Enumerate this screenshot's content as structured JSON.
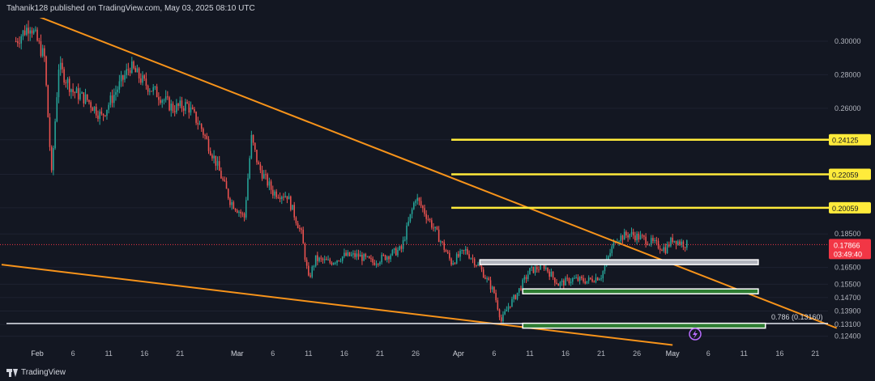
{
  "header": {
    "title": "Tahanik128 published on TradingView.com, May 03, 2025 08:10 UTC"
  },
  "footer": {
    "brand": "TradingView"
  },
  "colors": {
    "background": "#131722",
    "up": "#26a69a",
    "down": "#ef5350",
    "trendline": "#f7931a",
    "resistance": "#ffeb3b",
    "price_label": "#f23645"
  },
  "chart_data": {
    "type": "candlestick",
    "symbol_pair": "price",
    "ylim": [
      0.118,
      0.314
    ],
    "y_ticks": [
      "0.30000",
      "0.28000",
      "0.26000",
      "0.24125",
      "0.22059",
      "0.20059",
      "0.18500",
      "0.16500",
      "0.15500",
      "0.14700",
      "0.13900",
      "0.13100",
      "0.12400"
    ],
    "x_ticks": [
      "Feb",
      "6",
      "11",
      "16",
      "21",
      "Mar",
      "6",
      "11",
      "16",
      "21",
      "26",
      "Apr",
      "6",
      "11",
      "16",
      "21",
      "26",
      "May",
      "6",
      "11",
      "16",
      "21"
    ],
    "x_range": [
      "2025-01-27",
      "2025-05-23"
    ],
    "last_price": {
      "value": 0.17866,
      "label": "0.17866",
      "countdown": "03:49:40"
    },
    "resistance_levels": [
      {
        "label": "0.24125",
        "value": 0.24125,
        "from": "2025-03-31",
        "to": "2025-05-23"
      },
      {
        "label": "0.22059",
        "value": 0.22059,
        "from": "2025-03-31",
        "to": "2025-05-23"
      },
      {
        "label": "0.20059",
        "value": 0.20059,
        "from": "2025-03-31",
        "to": "2025-05-23"
      }
    ],
    "fib_level": {
      "label": "0.786 (0.13160)",
      "value": 0.1316
    },
    "zones": [
      {
        "kind": "gray",
        "low": 0.1672,
        "high": 0.1696,
        "from": "2025-04-04",
        "to": "2025-05-13"
      },
      {
        "kind": "green",
        "low": 0.1505,
        "high": 0.1522,
        "from": "2025-04-10",
        "to": "2025-05-13"
      },
      {
        "kind": "green",
        "low": 0.1299,
        "high": 0.1317,
        "from": "2025-04-10",
        "to": "2025-05-14"
      }
    ],
    "trendlines": [
      {
        "name": "upper",
        "from": [
          "2025-02-01",
          0.315
        ],
        "to": [
          "2025-05-24",
          0.1288
        ]
      },
      {
        "name": "lower",
        "from": [
          "2025-01-27",
          0.1667
        ],
        "to": [
          "2025-05-01",
          0.1187
        ]
      }
    ],
    "price_path": [
      [
        "2025-01-29",
        0.3
      ],
      [
        "2025-01-30",
        0.305
      ],
      [
        "2025-01-31",
        0.31
      ],
      [
        "2025-02-02",
        0.29
      ],
      [
        "2025-02-03",
        0.22
      ],
      [
        "2025-02-04",
        0.285
      ],
      [
        "2025-02-06",
        0.27
      ],
      [
        "2025-02-08",
        0.265
      ],
      [
        "2025-02-10",
        0.255
      ],
      [
        "2025-02-12",
        0.27
      ],
      [
        "2025-02-14",
        0.285
      ],
      [
        "2025-02-16",
        0.275
      ],
      [
        "2025-02-18",
        0.268
      ],
      [
        "2025-02-20",
        0.26
      ],
      [
        "2025-02-22",
        0.262
      ],
      [
        "2025-02-24",
        0.248
      ],
      [
        "2025-02-26",
        0.228
      ],
      [
        "2025-02-28",
        0.205
      ],
      [
        "2025-03-01",
        0.2
      ],
      [
        "2025-03-02",
        0.195
      ],
      [
        "2025-03-03",
        0.242
      ],
      [
        "2025-03-04",
        0.225
      ],
      [
        "2025-03-06",
        0.21
      ],
      [
        "2025-03-08",
        0.208
      ],
      [
        "2025-03-10",
        0.185
      ],
      [
        "2025-03-11",
        0.158
      ],
      [
        "2025-03-12",
        0.17
      ],
      [
        "2025-03-14",
        0.168
      ],
      [
        "2025-03-16",
        0.172
      ],
      [
        "2025-03-18",
        0.172
      ],
      [
        "2025-03-20",
        0.168
      ],
      [
        "2025-03-22",
        0.172
      ],
      [
        "2025-03-24",
        0.176
      ],
      [
        "2025-03-26",
        0.207
      ],
      [
        "2025-03-27",
        0.2
      ],
      [
        "2025-03-29",
        0.185
      ],
      [
        "2025-03-31",
        0.168
      ],
      [
        "2025-04-02",
        0.175
      ],
      [
        "2025-04-04",
        0.165
      ],
      [
        "2025-04-06",
        0.15
      ],
      [
        "2025-04-07",
        0.133
      ],
      [
        "2025-04-08",
        0.142
      ],
      [
        "2025-04-09",
        0.148
      ],
      [
        "2025-04-11",
        0.163
      ],
      [
        "2025-04-13",
        0.166
      ],
      [
        "2025-04-15",
        0.155
      ],
      [
        "2025-04-17",
        0.158
      ],
      [
        "2025-04-19",
        0.157
      ],
      [
        "2025-04-21",
        0.16
      ],
      [
        "2025-04-23",
        0.182
      ],
      [
        "2025-04-25",
        0.185
      ],
      [
        "2025-04-27",
        0.182
      ],
      [
        "2025-04-29",
        0.178
      ],
      [
        "2025-04-30",
        0.176
      ],
      [
        "2025-05-01",
        0.182
      ],
      [
        "2025-05-02",
        0.18
      ],
      [
        "2025-05-03",
        0.1787
      ]
    ]
  }
}
